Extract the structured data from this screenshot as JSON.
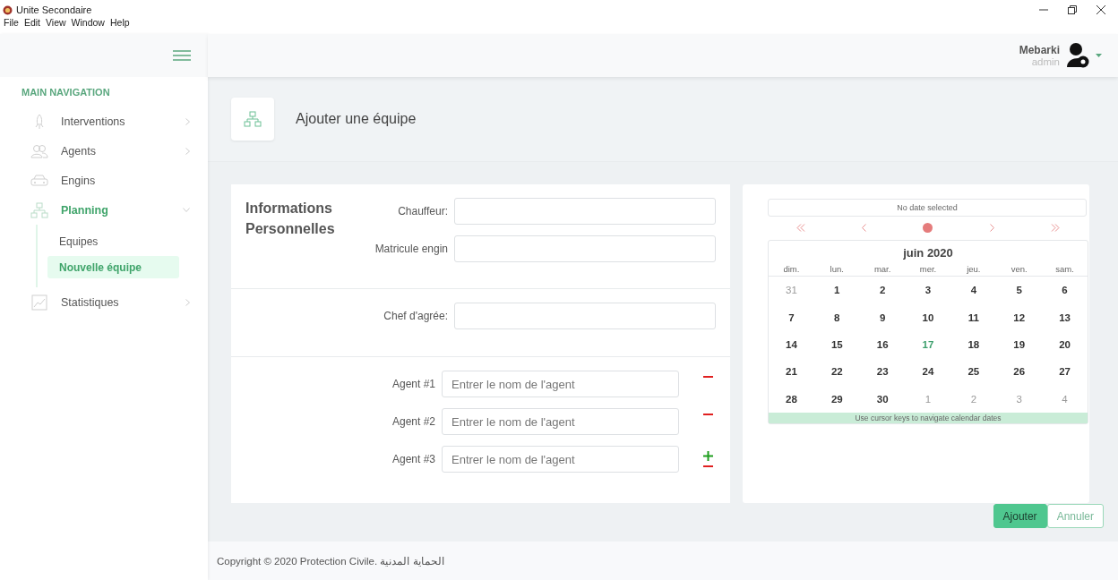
{
  "window": {
    "title": "Unite Secondaire",
    "menu": [
      "File",
      "Edit",
      "View",
      "Window",
      "Help"
    ]
  },
  "header": {
    "user": "Mebarki",
    "role": "admin"
  },
  "sidebar": {
    "heading": "MAIN NAVIGATION",
    "items": [
      {
        "label": "Interventions",
        "expanded": false,
        "active": false
      },
      {
        "label": "Agents",
        "expanded": false,
        "active": false
      },
      {
        "label": "Engins",
        "active": false
      },
      {
        "label": "Planning",
        "expanded": true,
        "active": true,
        "children": [
          {
            "label": "Equipes",
            "selected": false
          },
          {
            "label": "Nouvelle équipe",
            "selected": true
          }
        ]
      },
      {
        "label": "Statistiques",
        "expanded": false,
        "active": false
      }
    ]
  },
  "page": {
    "title": "Ajouter une équipe"
  },
  "form": {
    "section_title": "Informations Personnelles",
    "fields": [
      {
        "label": "Chauffeur:"
      },
      {
        "label": "Matricule engin"
      }
    ],
    "chef": {
      "label": "Chef d'agrée:"
    },
    "agents": [
      {
        "label": "Agent #1",
        "placeholder": "Entrer le nom de l'agent",
        "addable": false
      },
      {
        "label": "Agent #2",
        "placeholder": "Entrer le nom de l'agent",
        "addable": false
      },
      {
        "label": "Agent #3",
        "placeholder": "Entrer le nom de l'agent",
        "addable": true
      }
    ]
  },
  "calendar": {
    "value": "No date selected",
    "month": "juin 2020",
    "weekdays": [
      "dim.",
      "lun.",
      "mar.",
      "mer.",
      "jeu.",
      "ven.",
      "sam."
    ],
    "weeks": [
      [
        {
          "day": "31",
          "muted": true
        },
        {
          "day": "1",
          "muted": false
        },
        {
          "day": "2",
          "muted": false
        },
        {
          "day": "3",
          "muted": false
        },
        {
          "day": "4",
          "muted": false
        },
        {
          "day": "5",
          "muted": false
        },
        {
          "day": "6",
          "muted": false
        }
      ],
      [
        {
          "day": "7",
          "muted": false
        },
        {
          "day": "8",
          "muted": false
        },
        {
          "day": "9",
          "muted": false
        },
        {
          "day": "10",
          "muted": false
        },
        {
          "day": "11",
          "muted": false
        },
        {
          "day": "12",
          "muted": false
        },
        {
          "day": "13",
          "muted": false
        }
      ],
      [
        {
          "day": "14",
          "muted": false
        },
        {
          "day": "15",
          "muted": false
        },
        {
          "day": "16",
          "muted": false
        },
        {
          "day": "17",
          "muted": false,
          "today": true
        },
        {
          "day": "18",
          "muted": false
        },
        {
          "day": "19",
          "muted": false
        },
        {
          "day": "20",
          "muted": false
        }
      ],
      [
        {
          "day": "21",
          "muted": false
        },
        {
          "day": "22",
          "muted": false
        },
        {
          "day": "23",
          "muted": false
        },
        {
          "day": "24",
          "muted": false
        },
        {
          "day": "25",
          "muted": false
        },
        {
          "day": "26",
          "muted": false
        },
        {
          "day": "27",
          "muted": false
        }
      ],
      [
        {
          "day": "28",
          "muted": false
        },
        {
          "day": "29",
          "muted": false
        },
        {
          "day": "30",
          "muted": false
        },
        {
          "day": "1",
          "muted": true
        },
        {
          "day": "2",
          "muted": true
        },
        {
          "day": "3",
          "muted": true
        },
        {
          "day": "4",
          "muted": true
        }
      ]
    ],
    "hint": "Use cursor keys to navigate calendar dates"
  },
  "buttons": [
    {
      "label": "Ajouter",
      "kind": "primary"
    },
    {
      "label": "Annuler",
      "kind": "outline"
    }
  ],
  "footer": {
    "text": "Copyright © 2020 Protection Civile. الحماية المدنية"
  }
}
